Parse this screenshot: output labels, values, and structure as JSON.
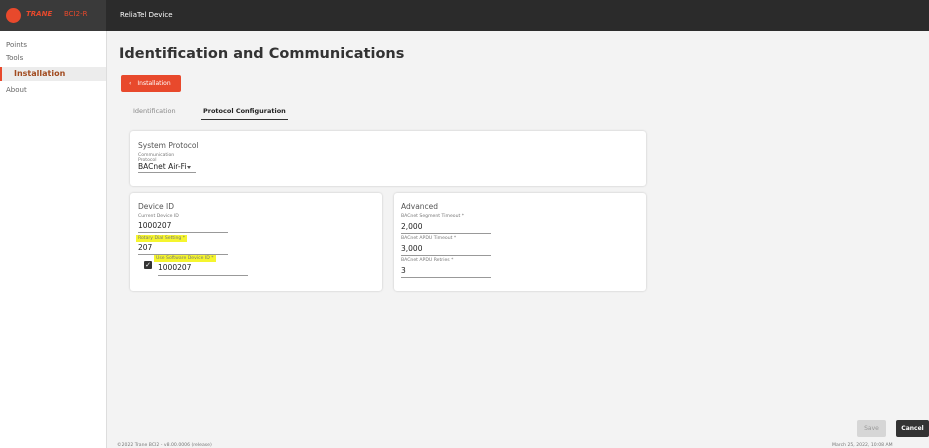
{
  "brand": {
    "name": "TRANE",
    "model": "BCI2-R",
    "logo_icon": "trane-logo-icon"
  },
  "header": {
    "device_title": "ReliaTel Device"
  },
  "sidebar": {
    "items": [
      {
        "label": "Points"
      },
      {
        "label": "Tools"
      },
      {
        "label": "Installation",
        "active": true
      },
      {
        "label": "About"
      }
    ]
  },
  "main": {
    "title": "Identification and Communications",
    "back_button": "Installation",
    "tabs": [
      {
        "label": "Identification"
      },
      {
        "label": "Protocol Configuration",
        "active": true
      }
    ],
    "system_protocol": {
      "title": "System Protocol",
      "comm_label_1": "Communication",
      "comm_label_2": "Protocol",
      "comm_value": "BACnet Air-Fi"
    },
    "device_id": {
      "title": "Device ID",
      "current_label": "Current Device ID",
      "current_value": "1000207",
      "rotary_label": "Rotary Dial Setting *",
      "rotary_value": "207",
      "software_label": "Use Software Device ID *",
      "software_value": "1000207",
      "software_checked": true
    },
    "advanced": {
      "title": "Advanced",
      "segment_label": "BACnet Segment Timeout *",
      "segment_value": "2,000",
      "apdu_timeout_label": "BACnet APDU Timeout *",
      "apdu_timeout_value": "3,000",
      "apdu_retries_label": "BACnet APDU Retries *",
      "apdu_retries_value": "3"
    },
    "save_label": "Save",
    "cancel_label": "Cancel"
  },
  "footer": {
    "copyright": "©2022 Trane BCI2 - v8.00.0006 (release)",
    "timestamp": "March 25, 2022, 10:08 AM"
  },
  "colors": {
    "accent": "#e8492c",
    "topbar": "#2b2b2b",
    "highlight": "#f5f52e"
  }
}
